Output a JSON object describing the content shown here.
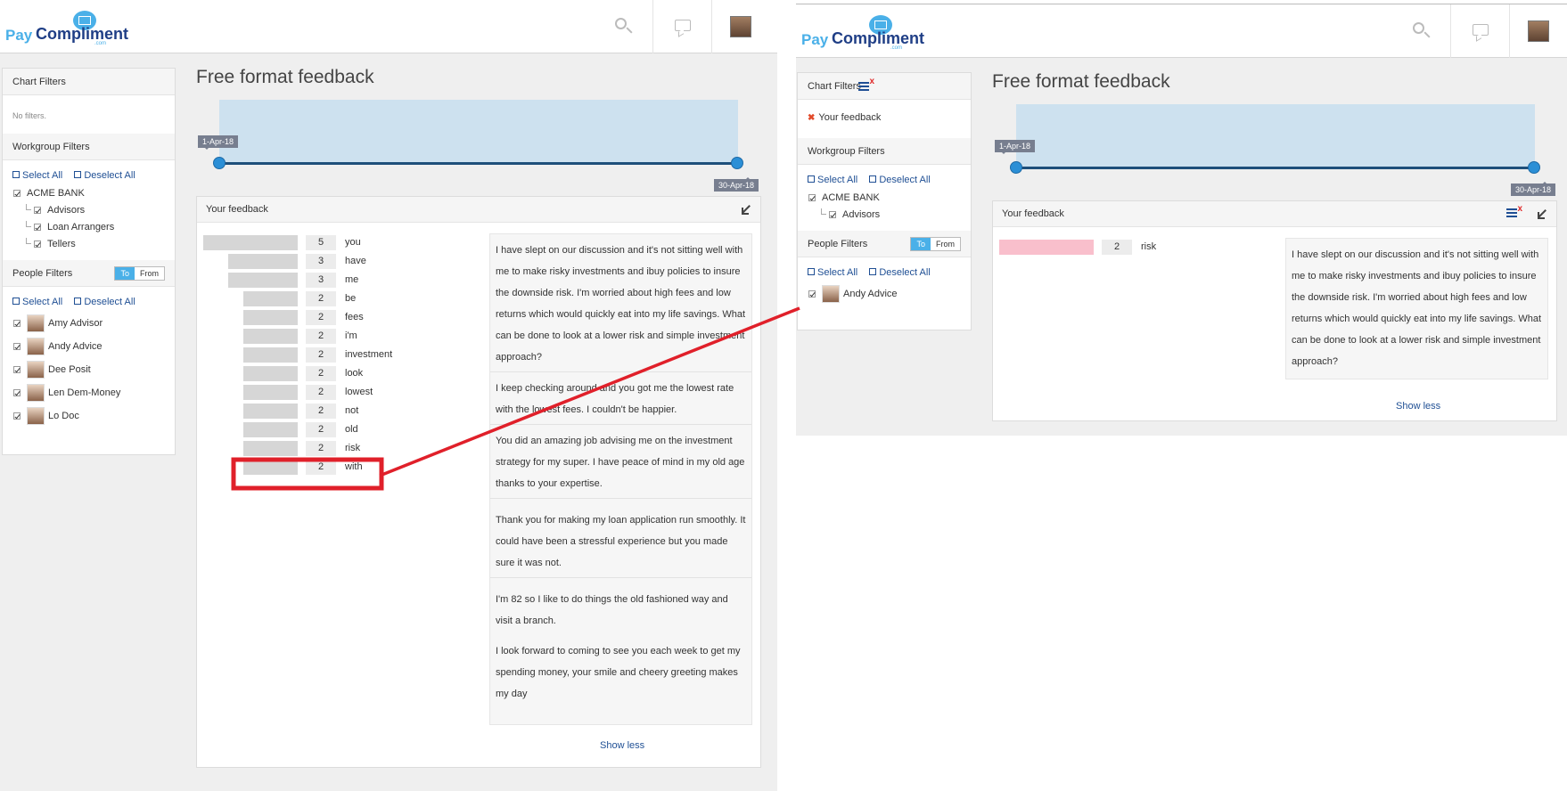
{
  "brand": {
    "logo_part1": "Pay",
    "logo_part2": "Compliment",
    "logo_suffix": ".com",
    "color_light": "#4ab0e8",
    "color_dark": "#1f3e86"
  },
  "topbar": {
    "search_icon": "search-icon",
    "chat_icon": "chat-icon",
    "avatar": "user-avatar"
  },
  "left": {
    "chart_filters": {
      "title": "Chart Filters",
      "empty_text": "No filters."
    },
    "workgroup_filters": {
      "title": "Workgroup Filters",
      "select_all": "Select All",
      "deselect_all": "Deselect All",
      "root": "ACME BANK",
      "children": [
        "Advisors",
        "Loan Arrangers",
        "Tellers"
      ]
    },
    "people_filters": {
      "title": "People Filters",
      "toggle_to": "To",
      "toggle_from": "From",
      "select_all": "Select All",
      "deselect_all": "Deselect All",
      "people": [
        "Amy Advisor",
        "Andy Advice",
        "Dee Posit",
        "Len Dem-Money",
        "Lo Doc"
      ]
    },
    "page_title": "Free format feedback",
    "slider": {
      "start_label": "1-Apr-18",
      "end_label": "30-Apr-18"
    },
    "feedback": {
      "title": "Your feedback",
      "words": [
        {
          "word": "you",
          "count": 5
        },
        {
          "word": "have",
          "count": 3
        },
        {
          "word": "me",
          "count": 3
        },
        {
          "word": "be",
          "count": 2
        },
        {
          "word": "fees",
          "count": 2
        },
        {
          "word": "i'm",
          "count": 2
        },
        {
          "word": "investment",
          "count": 2
        },
        {
          "word": "look",
          "count": 2
        },
        {
          "word": "lowest",
          "count": 2
        },
        {
          "word": "not",
          "count": 2
        },
        {
          "word": "old",
          "count": 2
        },
        {
          "word": "risk",
          "count": 2
        },
        {
          "word": "with",
          "count": 2
        }
      ],
      "comments": [
        "I have slept on our discussion and it's not sitting well with me to make risky investments and ibuy policies to insure the downside risk. I'm worried about high fees and low returns which would quickly eat into my life savings. What can be done to look at a lower risk and simple investment approach?",
        "I keep checking around and you got me the lowest rate with the lowest fees. I couldn't be happier.",
        "You did an amazing job advising me on the investment strategy for my super. I have peace of mind in my old age thanks to your expertise.",
        "Thank you for making my loan application run smoothly. It could have been a stressful experience but you made sure it was not.",
        "I'm 82 so I like to do things the old fashioned way and visit a branch.",
        "I look forward to coming to see you each week to get my spending money, your smile and cheery greeting makes my day"
      ],
      "show_less": "Show less"
    }
  },
  "right": {
    "chart_filters": {
      "title": "Chart Filters",
      "active_filter": "Your feedback"
    },
    "workgroup_filters": {
      "title": "Workgroup Filters",
      "select_all": "Select All",
      "deselect_all": "Deselect All",
      "root": "ACME BANK",
      "children": [
        "Advisors"
      ]
    },
    "people_filters": {
      "title": "People Filters",
      "toggle_to": "To",
      "toggle_from": "From",
      "select_all": "Select All",
      "deselect_all": "Deselect All",
      "people": [
        "Andy Advice"
      ]
    },
    "page_title": "Free format feedback",
    "slider": {
      "start_label": "1-Apr-18",
      "end_label": "30-Apr-18"
    },
    "feedback": {
      "title": "Your feedback",
      "words": [
        {
          "word": "risk",
          "count": 2
        }
      ],
      "comments": [
        "I have slept on our discussion and it's not sitting well with me to make risky investments and ibuy policies to insure the downside risk. I'm worried about high fees and low returns which would quickly eat into my life savings. What can be done to look at a lower risk and simple investment approach?"
      ],
      "show_less": "Show less"
    }
  },
  "annotation_color": "#e0202a",
  "highlight_color": "#f9bfcc"
}
